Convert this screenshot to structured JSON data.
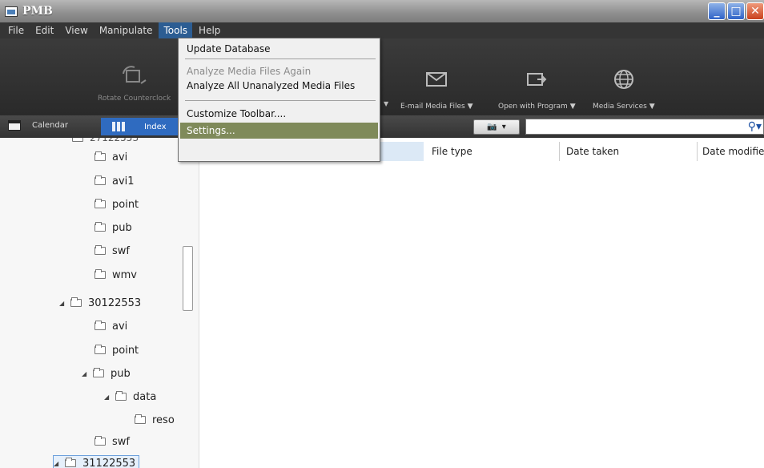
{
  "window": {
    "title": "PMB",
    "min_label": "_",
    "max_label": "□",
    "close_label": "✕"
  },
  "menubar": {
    "items": [
      "File",
      "Edit",
      "View",
      "Manipulate",
      "Tools",
      "Help"
    ]
  },
  "toolbar": {
    "rotate_label": "Rotate Counterclock",
    "email_label": "E-mail Media Files ▼",
    "open_label": "Open with Program ▼",
    "services_label": "Media Services ▼"
  },
  "subbar": {
    "calendar_label": "Calendar",
    "index_label": "Index",
    "search_placeholder": ""
  },
  "tools_menu": {
    "items": [
      {
        "label": "Update Database",
        "state": "normal"
      },
      {
        "label": "Analyze Media Files Again",
        "state": "disabled"
      },
      {
        "label": "Analyze All Unanalyzed Media Files",
        "state": "normal"
      },
      {
        "label": "Customize Toolbar....",
        "state": "normal"
      },
      {
        "label": "Settings...",
        "state": "highlighted"
      }
    ]
  },
  "tree": {
    "items": [
      {
        "label": "avi"
      },
      {
        "label": "avi1"
      },
      {
        "label": "point"
      },
      {
        "label": "pub"
      },
      {
        "label": "swf"
      },
      {
        "label": "wmv"
      },
      {
        "label": "30122553"
      },
      {
        "label": "avi"
      },
      {
        "label": "point"
      },
      {
        "label": "pub"
      },
      {
        "label": "data"
      },
      {
        "label": "reso"
      },
      {
        "label": "swf"
      },
      {
        "label": "31122553"
      }
    ]
  },
  "table": {
    "columns": [
      "File type",
      "Date taken",
      "Date modified"
    ]
  },
  "colors": {
    "menubar": "#353535",
    "active_menu": "#2c5d93",
    "highlight": "#7f8a5a",
    "index_tab": "#2f6bc0"
  }
}
